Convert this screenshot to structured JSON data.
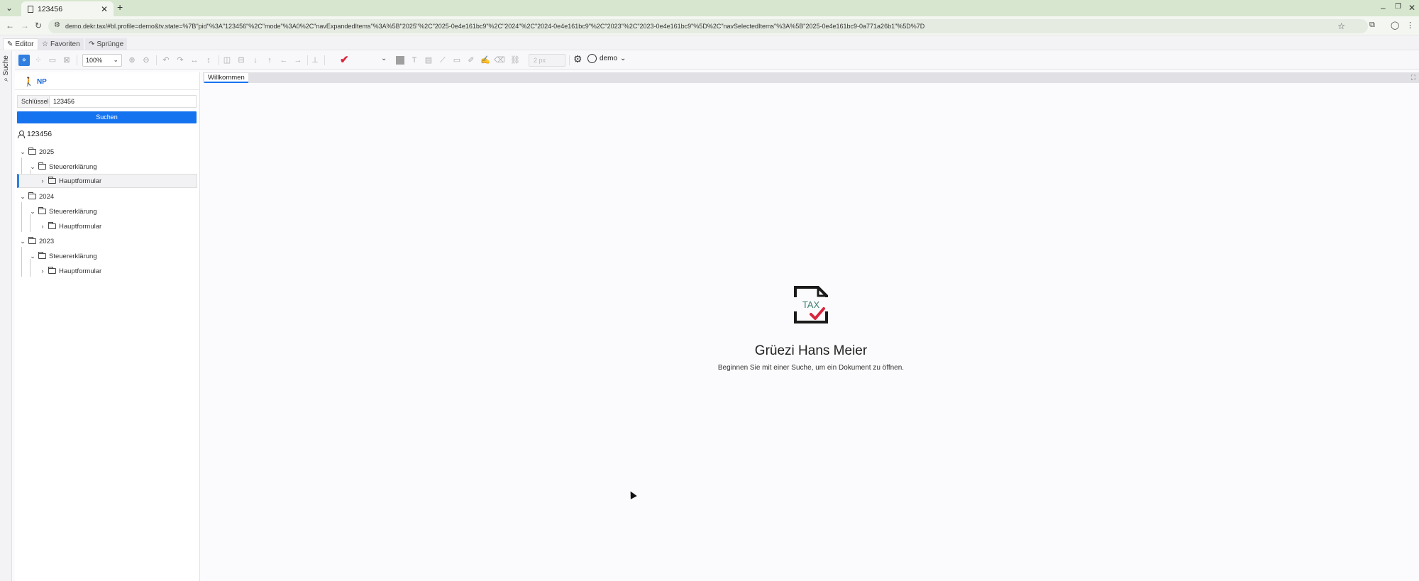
{
  "browser": {
    "tab_title": "123456",
    "url": "demo.dekr.tax/#bl.profile=demo&tv.state=%7B\"pid\"%3A\"123456\"%2C\"mode\"%3A0%2C\"navExpandedItems\"%3A%5B\"2025\"%2C\"2025-0e4e161bc9\"%2C\"2024\"%2C\"2024-0e4e161bc9\"%2C\"2023\"%2C\"2023-0e4e161bc9\"%5D%2C\"navSelectedItems\"%3A%5B\"2025-0e4e161bc9-0a771a26b1\"%5D%7D"
  },
  "modes": {
    "editor": "Editor",
    "favorites": "Favoriten",
    "jumps": "Sprünge"
  },
  "sidebar_rail": {
    "search_label": "Suche"
  },
  "toolbar": {
    "zoom": "100%",
    "stroke_width_placeholder": "2 px",
    "profile": "demo",
    "icons": [
      "select-tool-icon",
      "region-tool-icon",
      "image-icon",
      "hide-image-icon",
      "zoom-in-icon",
      "zoom-out-icon",
      "undo-icon",
      "redo-icon",
      "fit-width-icon",
      "fit-height-icon",
      "split-vertical-icon",
      "split-horizontal-icon",
      "arrow-down-icon",
      "arrow-up-icon",
      "arrow-left-icon",
      "arrow-right-icon",
      "stamp-icon",
      "checkmark-icon",
      "color-swatch",
      "text-icon",
      "comment-icon",
      "line-icon",
      "rectangle-icon",
      "marker-icon",
      "signature-icon",
      "eraser-icon",
      "link-icon",
      "gear-icon"
    ],
    "accent_color": "#d9263f"
  },
  "left_panel": {
    "np_label": "NP",
    "key_label": "Schlüssel",
    "key_value": "123456",
    "search_button": "Suchen",
    "user_id": "123456",
    "tree": [
      {
        "label": "2025",
        "level": 0,
        "expanded": true
      },
      {
        "label": "Steuererklärung",
        "level": 1,
        "expanded": true
      },
      {
        "label": "Hauptformular",
        "level": 2,
        "expanded": false,
        "selected": true
      },
      {
        "label": "2024",
        "level": 0,
        "expanded": true
      },
      {
        "label": "Steuererklärung",
        "level": 1,
        "expanded": true
      },
      {
        "label": "Hauptformular",
        "level": 2,
        "expanded": false
      },
      {
        "label": "2023",
        "level": 0,
        "expanded": true
      },
      {
        "label": "Steuererklärung",
        "level": 1,
        "expanded": true
      },
      {
        "label": "Hauptformular",
        "level": 2,
        "expanded": false
      }
    ]
  },
  "content": {
    "tab_label": "Willkommen",
    "logo_text": "TAX",
    "greeting": "Grüezi Hans Meier",
    "subtitle": "Beginnen Sie mit einer Suche, um ein Dokument zu öffnen."
  },
  "colors": {
    "primary": "#1673f0",
    "titlebar": "#d7e6cf"
  }
}
